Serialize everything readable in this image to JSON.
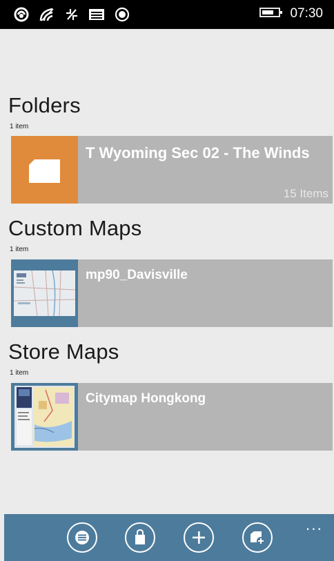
{
  "status_bar": {
    "time": "07:30",
    "icons": [
      "nfc-icon",
      "wifi-icon",
      "data-transfer-icon",
      "message-icon",
      "location-icon",
      "battery-icon"
    ]
  },
  "sections": {
    "folders": {
      "title": "Folders",
      "count": "1 item",
      "items": [
        {
          "name": "T Wyoming Sec 02 - The Winds",
          "sub": "15 Items",
          "thumb_color": "#e08a3c"
        }
      ]
    },
    "custom_maps": {
      "title": "Custom Maps",
      "count": "1 item",
      "items": [
        {
          "name": "mp90_Davisville",
          "thumb_color": "#4d7b9c"
        }
      ]
    },
    "store_maps": {
      "title": "Store Maps",
      "count": "1 item",
      "items": [
        {
          "name": "Citymap Hongkong",
          "thumb_color": "#4d7b9c"
        }
      ]
    }
  },
  "app_bar": {
    "background": "#4d7b9c",
    "buttons": [
      "list-icon",
      "store-bag-icon",
      "add-icon",
      "add-folder-icon"
    ],
    "more_label": "..."
  },
  "colors": {
    "page_bg": "#ebebeb",
    "tile_bg": "#b5b5b5",
    "accent_orange": "#e08a3c",
    "accent_blue": "#4d7b9c"
  }
}
